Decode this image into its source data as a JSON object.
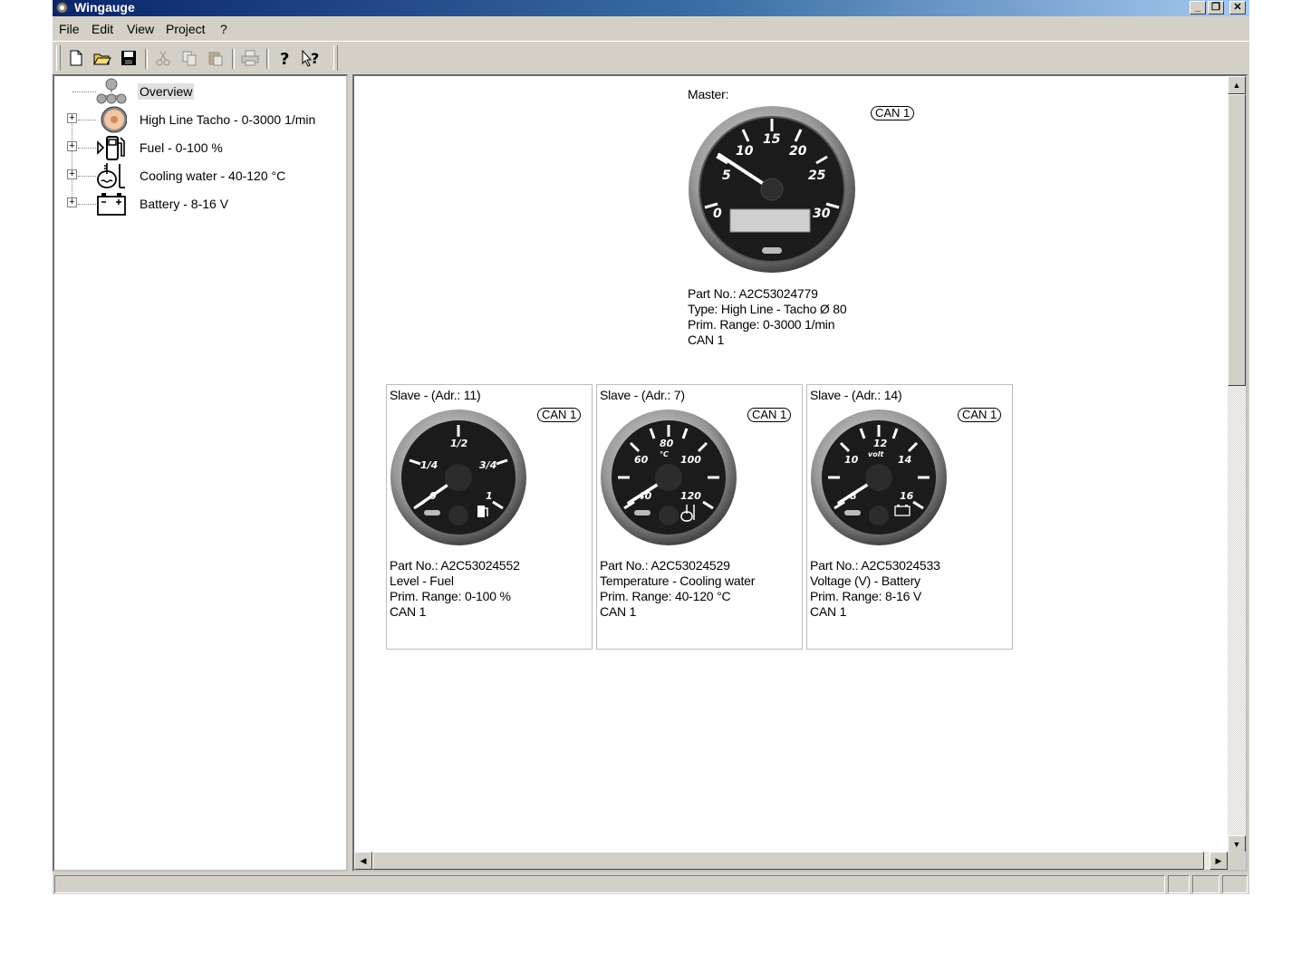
{
  "window": {
    "title": "Wingauge",
    "controls": {
      "minimize": "_",
      "restore": "❐",
      "close": "✕"
    }
  },
  "menu": [
    {
      "label": "File"
    },
    {
      "label": "Edit"
    },
    {
      "label": "View"
    },
    {
      "label": "Project"
    },
    {
      "label": "?"
    }
  ],
  "toolbar": {
    "buttons": [
      {
        "icon": "new-document-icon"
      },
      {
        "icon": "open-folder-icon"
      },
      {
        "icon": "save-icon"
      },
      {
        "icon": "cut-icon"
      },
      {
        "icon": "copy-icon"
      },
      {
        "icon": "paste-icon"
      },
      {
        "icon": "print-icon"
      },
      {
        "icon": "help-icon"
      },
      {
        "icon": "context-help-icon"
      }
    ]
  },
  "tree": {
    "items": [
      {
        "label": "Overview",
        "icon": "overview-network-icon",
        "selected": true
      },
      {
        "label": "High Line Tacho - 0-3000 1/min",
        "icon": "tacho-gauge-icon"
      },
      {
        "label": "Fuel - 0-100 %",
        "icon": "fuel-pump-icon"
      },
      {
        "label": "Cooling water - 40-120 °C",
        "icon": "coolant-icon"
      },
      {
        "label": "Battery - 8-16 V",
        "icon": "battery-icon"
      }
    ]
  },
  "overview": {
    "master": {
      "heading": "Master:",
      "can_label": "CAN 1",
      "gauge_labels": [
        "0",
        "5",
        "10",
        "15",
        "20",
        "25",
        "30"
      ],
      "lines": [
        "Part No.: A2C53024779",
        "Type: High Line - Tacho Ø 80",
        "Prim. Range: 0-3000 1/min",
        "CAN 1"
      ]
    },
    "slaves": [
      {
        "heading": "Slave - (Adr.: 11)",
        "can_label": "CAN 1",
        "gauge_labels": [
          "0",
          "1/4",
          "1/2",
          "3/4",
          "1"
        ],
        "lines": [
          "Part No.: A2C53024552",
          "Level - Fuel",
          "Prim. Range: 0-100 %",
          "CAN 1"
        ]
      },
      {
        "heading": "Slave - (Adr.: 7)",
        "can_label": "CAN 1",
        "gauge_labels": [
          "40",
          "60",
          "80",
          "100",
          "120"
        ],
        "unit": "°C",
        "lines": [
          "Part No.: A2C53024529",
          "Temperature - Cooling water",
          "Prim. Range: 40-120 °C",
          "CAN 1"
        ]
      },
      {
        "heading": "Slave - (Adr.: 14)",
        "can_label": "CAN 1",
        "gauge_labels": [
          "8",
          "10",
          "12",
          "14",
          "16"
        ],
        "unit": "volt",
        "lines": [
          "Part No.: A2C53024533",
          "Voltage (V) - Battery",
          "Prim. Range: 8-16 V",
          "CAN 1"
        ]
      }
    ]
  }
}
